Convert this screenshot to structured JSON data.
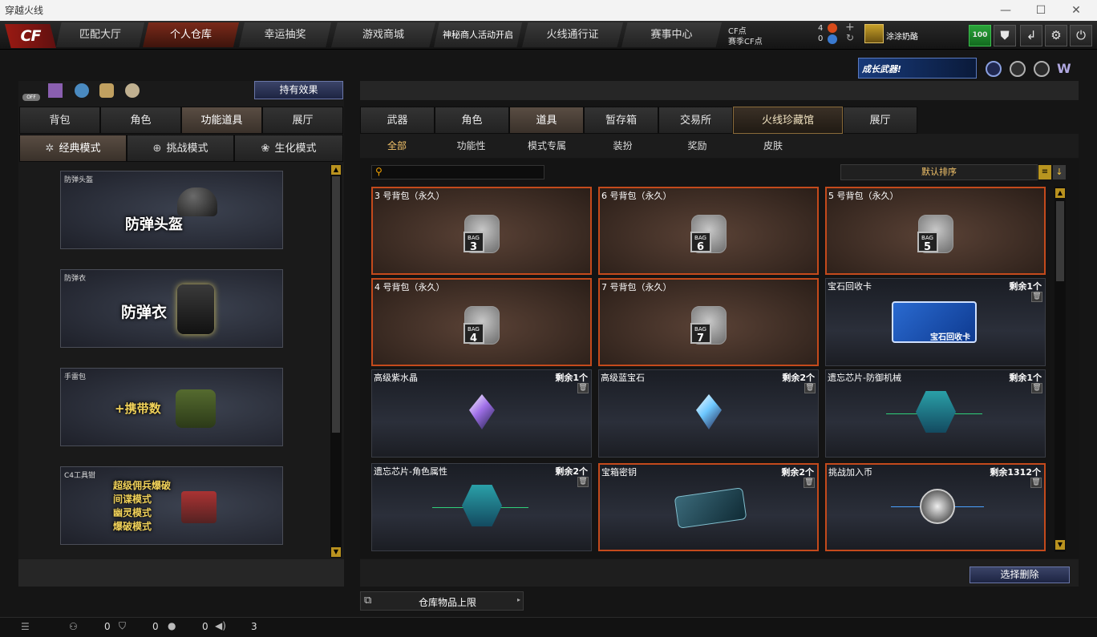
{
  "window": {
    "title": "穿越火线",
    "minimize": "—",
    "maximize": "☐",
    "close": "✕"
  },
  "logo": "CF",
  "nav": {
    "tabs": [
      "匹配大厅",
      "个人仓库",
      "幸运抽奖",
      "游戏商城",
      "神秘商人活动开启",
      "火线通行证",
      "赛事中心"
    ],
    "active_index": 1
  },
  "cf": {
    "cf_label": "CF点",
    "cf_value": "4",
    "match_label": "赛季CF点",
    "match_value": "0",
    "username": "涂涂奶酪",
    "level": "100"
  },
  "banner": {
    "text": "成长武器!"
  },
  "left": {
    "effect_button": "持有效果",
    "off_label": "OFF",
    "tabs": [
      "背包",
      "角色",
      "功能道具",
      "展厅"
    ],
    "active_tab": 2,
    "modes": [
      "经典模式",
      "挑战模式",
      "生化模式"
    ],
    "active_mode": 0,
    "cards": [
      {
        "name": "防弹头盔",
        "big": "防弹头盔"
      },
      {
        "name": "防弹衣",
        "big": "防弹衣"
      },
      {
        "name": "手雷包",
        "big": "+携带数"
      },
      {
        "name": "C4工具钳",
        "lines": [
          "超级佣兵爆破",
          "间谍模式",
          "幽灵模式",
          "爆破模式"
        ]
      }
    ]
  },
  "right": {
    "tabs": [
      "武器",
      "角色",
      "道具",
      "暂存箱",
      "交易所",
      "火线珍藏馆",
      "展厅"
    ],
    "active_tab": 2,
    "gold_tab": 5,
    "subtabs": [
      "全部",
      "功能性",
      "模式专属",
      "装扮",
      "奖励",
      "皮肤"
    ],
    "active_subtab": 0,
    "search": {
      "placeholder": ""
    },
    "sort": {
      "label": "默认排序"
    },
    "items": [
      {
        "name": "3 号背包（永久）",
        "count": "",
        "icon": "bag",
        "num": "3",
        "style": "brown"
      },
      {
        "name": "6 号背包（永久）",
        "count": "",
        "icon": "bag",
        "num": "6",
        "style": "brown"
      },
      {
        "name": "5 号背包（永久）",
        "count": "",
        "icon": "bag",
        "num": "5",
        "style": "brown"
      },
      {
        "name": "4 号背包（永久）",
        "count": "",
        "icon": "bag",
        "num": "4",
        "style": "brown"
      },
      {
        "name": "7 号背包（永久）",
        "count": "",
        "icon": "bag",
        "num": "7",
        "style": "brown"
      },
      {
        "name": "宝石回收卡",
        "count": "剩余1个",
        "icon": "card",
        "card_text": "宝石回收卡",
        "style": "plain"
      },
      {
        "name": "高级紫水晶",
        "count": "剩余1个",
        "icon": "gem-purple",
        "style": "plain"
      },
      {
        "name": "高级蓝宝石",
        "count": "剩余2个",
        "icon": "gem-blue",
        "style": "plain"
      },
      {
        "name": "遗忘芯片-防御机械",
        "count": "剩余1个",
        "icon": "chip-red",
        "style": "plain"
      },
      {
        "name": "遗忘芯片-角色属性",
        "count": "剩余2个",
        "icon": "chip-blue",
        "style": "plain"
      },
      {
        "name": "宝箱密钥",
        "count": "剩余2个",
        "icon": "key",
        "style": "orange"
      },
      {
        "name": "挑战加入币",
        "count": "剩余1312个",
        "icon": "coin",
        "style": "orange"
      }
    ],
    "select_delete": "选择删除",
    "capacity": "仓库物品上限"
  },
  "status": {
    "a": "0",
    "b": "0",
    "c": "0",
    "d": "3"
  },
  "colors": {
    "accent": "#c44a1c",
    "gold": "#f3c36a",
    "level_green": "#1c8a2a"
  }
}
